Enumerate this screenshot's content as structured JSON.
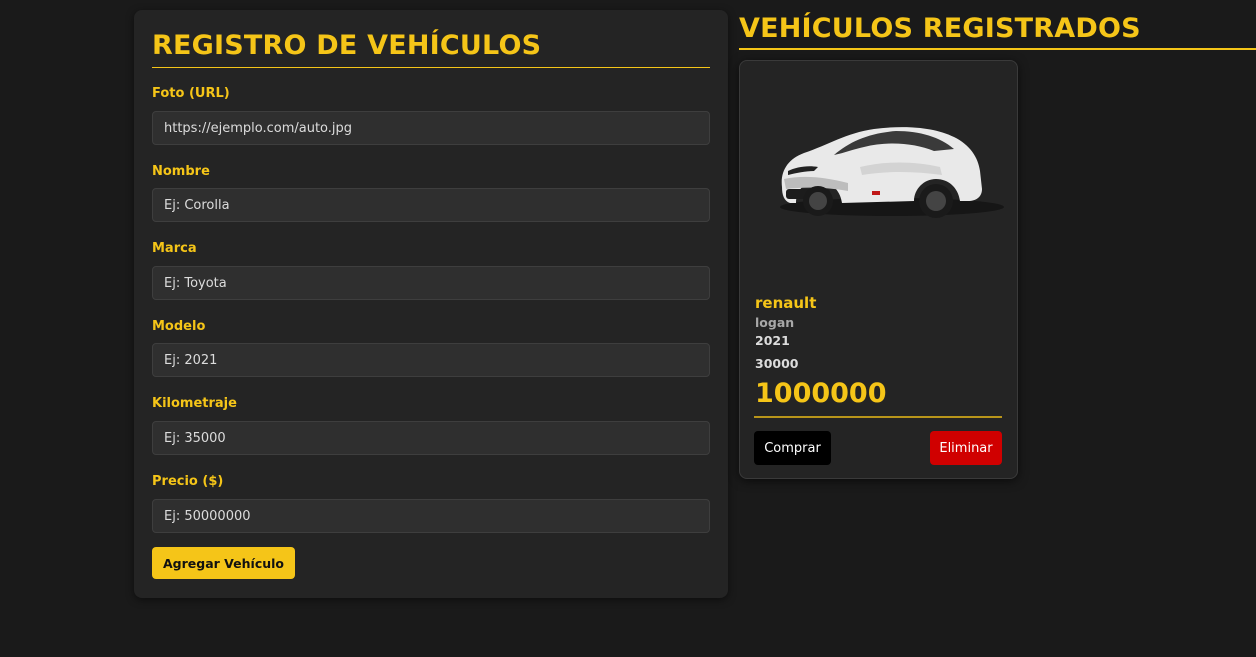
{
  "form": {
    "title": "REGISTRO DE VEHÍCULOS",
    "fields": [
      {
        "label": "Foto (URL)",
        "placeholder": "https://ejemplo.com/auto.jpg",
        "value": ""
      },
      {
        "label": "Nombre",
        "placeholder": "Ej: Corolla",
        "value": ""
      },
      {
        "label": "Marca",
        "placeholder": "Ej: Toyota",
        "value": ""
      },
      {
        "label": "Modelo",
        "placeholder": "Ej: 2021",
        "value": ""
      },
      {
        "label": "Kilometraje",
        "placeholder": "Ej: 35000",
        "value": ""
      },
      {
        "label": "Precio ($)",
        "placeholder": "Ej: 50000000",
        "value": ""
      }
    ],
    "submit_label": "Agregar Vehículo"
  },
  "list": {
    "title": "VEHÍCULOS REGISTRADOS",
    "vehicles": [
      {
        "image": "car-photo",
        "brand": "renault",
        "model": "logan",
        "year": "2021",
        "km": "30000",
        "price": "1000000",
        "buy_label": "Comprar",
        "delete_label": "Eliminar"
      }
    ]
  },
  "colors": {
    "background": "#1a1a1a",
    "panel": "#242424",
    "accent": "#f5c518",
    "danger": "#d00000",
    "buy": "#000000"
  }
}
